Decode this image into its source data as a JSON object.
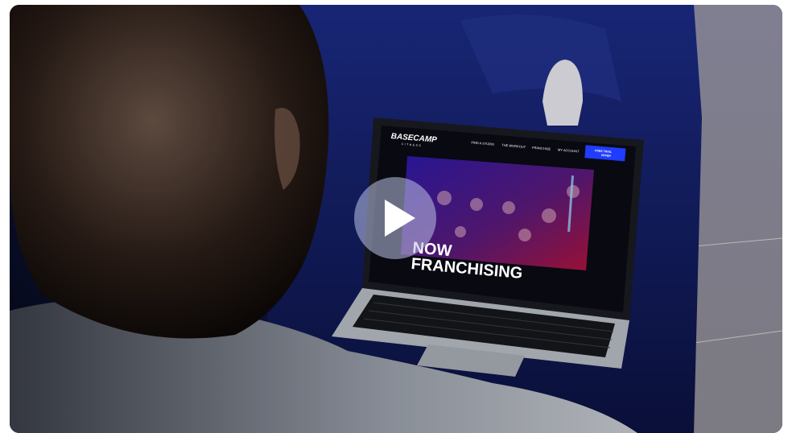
{
  "site": {
    "logo": "BASECAMP",
    "logo_sub": "FITNESS",
    "nav": [
      "FIND A STUDIO",
      "THE WORKOUT",
      "FRANCHISE",
      "MY ACCOUNT"
    ],
    "cta_line1": "FREE TRIAL",
    "cta_line2": "OFFER",
    "hero_line1": "NOW",
    "hero_line2": "FRANCHISING"
  },
  "player": {
    "play_icon": "play-icon"
  },
  "colors": {
    "accent": "#1f3cff",
    "overlay": "#bec3e6"
  }
}
